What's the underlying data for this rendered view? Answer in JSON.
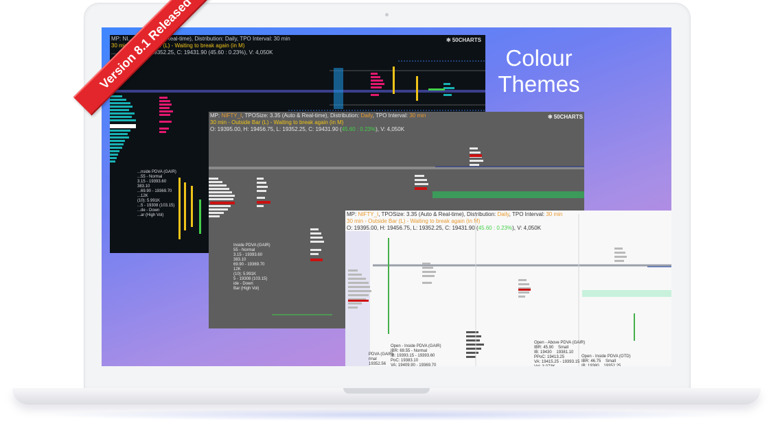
{
  "ribbon": {
    "label": "Version 8.1 Released"
  },
  "tagline": {
    "line1": "Colour",
    "line2": "Themes"
  },
  "logo": {
    "text": "50CHARTS"
  },
  "panels": {
    "dark": {
      "line1": "MP: NI... 3.35 (Auto & Real-time), Distribution: Daily, TPO Interval: 30 min",
      "line2": "30 min - Outside Bar (L) - Waiting to break again (in M)",
      "line3": "..., 19456.75, L: 19352.25, C: 19431.90 (45.60 : 0.23%), V: 4,050K",
      "notes": "...nside PDVA (GAIR)\n...55 - Normal\n3.15 - 19393.60\n383.10\n...69.90 - 19369.70\n...12K\n(10): 5.991K\n...5 - 19308 (103.15)\n...de - Down\n...ar (High Vol)"
    },
    "grey": {
      "line1a": "MP: ",
      "symbol": "NIFTY_I",
      "line1b": ", TPOSize: 3.35 (Auto & Real-time), Distribution: ",
      "dist": "Daily",
      "line1c": ", TPO Interval: ",
      "interval": "30 min",
      "line2": "30 min - Outside Bar (L) - Waiting to break again (in M)",
      "line3a": "O: 19395.00, H: 19456.75, L: 19352.25, C: 19431.90 (",
      "change": "45.60 : 0.23%",
      "line3b": "), V: 4,050K",
      "notes": "Inside PDVA (GAIR)\n55 - Normal\n3.15 - 19393.60\n383.10\n69.90 - 19369.70\n12K\n(10): 5.991K\n5 - 19308 (103.15)\nide - Down\nBar (High Vol)"
    },
    "light": {
      "line1a": "MP: ",
      "symbol": "NIFTY_I",
      "line1b": ", TPOSize: 3.35 (Auto & Real-time), Distribution: ",
      "dist": "Daily",
      "line1c": ", TPO Interval: ",
      "interval": "30 min",
      "line2": "30 min - Outside Bar (L) - Waiting to break again (in M)",
      "line3a": "O: 19395.00, H: 19456.75, L: 19352.25, C: 19431.90 (",
      "change": "45.60 : 0.23%",
      "line3b": "), V: 4,050K",
      "note1": "PDVA (GAIR)\nrmal\n19352.56",
      "note2": "Open - Inside PDVA (GAIR)\nIBR: 69.55 - Normal\nIB: 19393.15 - 19393.60\nPoC: 19383.10\nVA: 19409.90 - 19369.70",
      "note3": "Open - Above PDVA (GAIR)\nIBR: 45.90    Small\nIB: 19430    19381.10\nPPoC: 19413.25\nVA: 19415.25 - 19393.15\nVol: 3.073K",
      "note4": "Open - Inside PDVA (OTD)\nIBR: 46.75    Small\nIB: 19380    19352.25"
    }
  }
}
